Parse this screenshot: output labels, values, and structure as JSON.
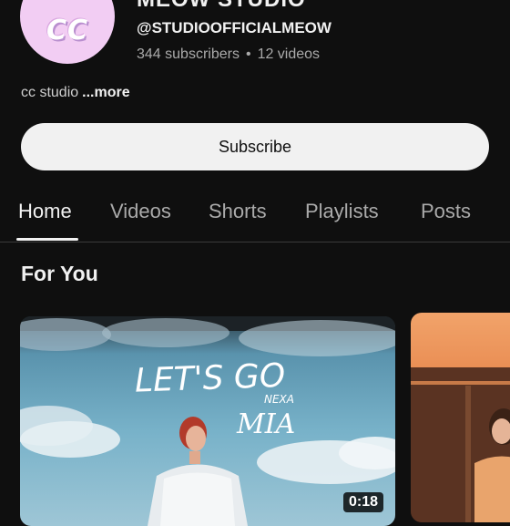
{
  "channel": {
    "avatar_text": "CC",
    "name": "MEOW STUDIO",
    "handle": "@STUDIOOFFICIALMEOW",
    "subscribers": "344 subscribers",
    "videos": "12 videos",
    "separator": "•",
    "description": "cc studio",
    "more_label": "...more"
  },
  "subscribe_label": "Subscribe",
  "tabs": [
    {
      "label": "Home",
      "active": true
    },
    {
      "label": "Videos"
    },
    {
      "label": "Shorts"
    },
    {
      "label": "Playlists"
    },
    {
      "label": "Posts"
    }
  ],
  "section": {
    "title": "For You"
  },
  "videos": [
    {
      "thumbnail_text": "LET'S GO",
      "thumbnail_subtext": "NEXA",
      "thumbnail_script": "MIA",
      "duration": "0:18"
    },
    {}
  ],
  "colors": {
    "background": "#0f0f0f",
    "avatar": "#f2cdf3",
    "subscribe_bg": "#f1f1f1"
  }
}
